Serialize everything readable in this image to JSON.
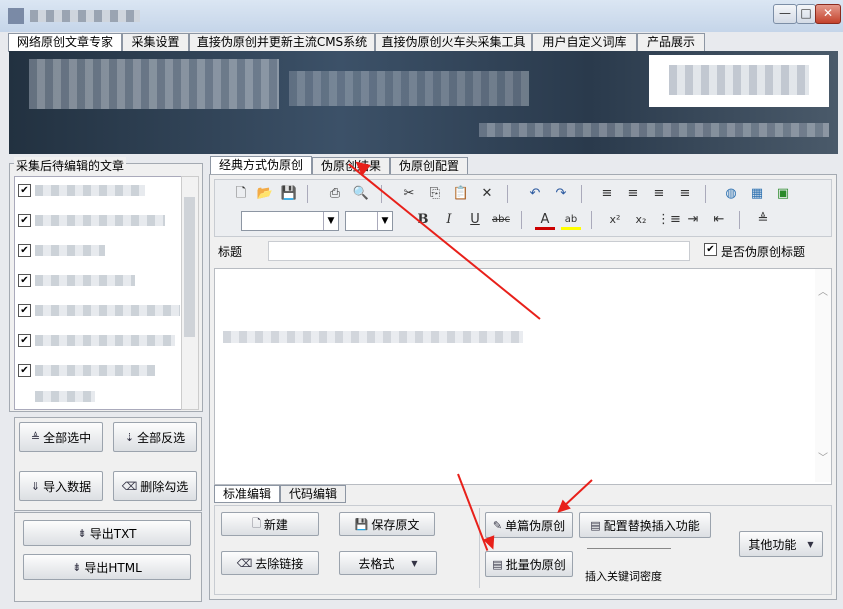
{
  "window": {
    "title": ""
  },
  "window_controls": {
    "minimize": "—",
    "maximize": "□",
    "close": "✕"
  },
  "main_tabs": [
    "网络原创文章专家",
    "采集设置",
    "直接伪原创并更新主流CMS系统",
    "直接伪原创火车头采集工具",
    "用户自定义词库",
    "产品展示"
  ],
  "left_panel": {
    "group_label": "采集后待编辑的文章",
    "buttons": {
      "select_all": "全部选中",
      "invert_all": "全部反选",
      "import": "导入数据",
      "delete_checked": "删除勾选",
      "export_txt": "导出TXT",
      "export_html": "导出HTML"
    }
  },
  "mode_tabs": [
    "经典方式伪原创",
    "伪原创结果",
    "伪原创配置"
  ],
  "title_row": {
    "label": "标题",
    "value": "",
    "checkbox_label": "是否伪原创标题",
    "checked": true
  },
  "editor_tabs": [
    "标准编辑",
    "代码编辑"
  ],
  "bottom_buttons": {
    "new": "新建",
    "save": "保存原文",
    "remove_links": "去除链接",
    "remove_format": "去格式",
    "single": "单篇伪原创",
    "batch": "批量伪原创",
    "config": "配置替换插入功能",
    "keyword_density": "插入关键词密度",
    "dropdown": "其他功能"
  },
  "icons": [
    "new-doc-icon",
    "open-folder-icon",
    "save-icon",
    "print-icon",
    "preview-icon",
    "cut-icon",
    "copy-icon",
    "paste-icon",
    "delete-icon",
    "undo-icon",
    "redo-icon",
    "align-left-icon",
    "align-center-icon",
    "align-right-icon",
    "justify-icon",
    "globe-icon",
    "table-icon",
    "image-icon",
    "bold-icon",
    "italic-icon",
    "underline-icon",
    "strike-icon",
    "font-color-icon",
    "highlight-icon",
    "superscript-icon",
    "subscript-icon",
    "numbered-list-icon",
    "indent-icon",
    "outdent-icon",
    "paragraph-icon"
  ],
  "colors": {
    "arrow": "#e8201a",
    "banner": "#2a3a4c"
  }
}
